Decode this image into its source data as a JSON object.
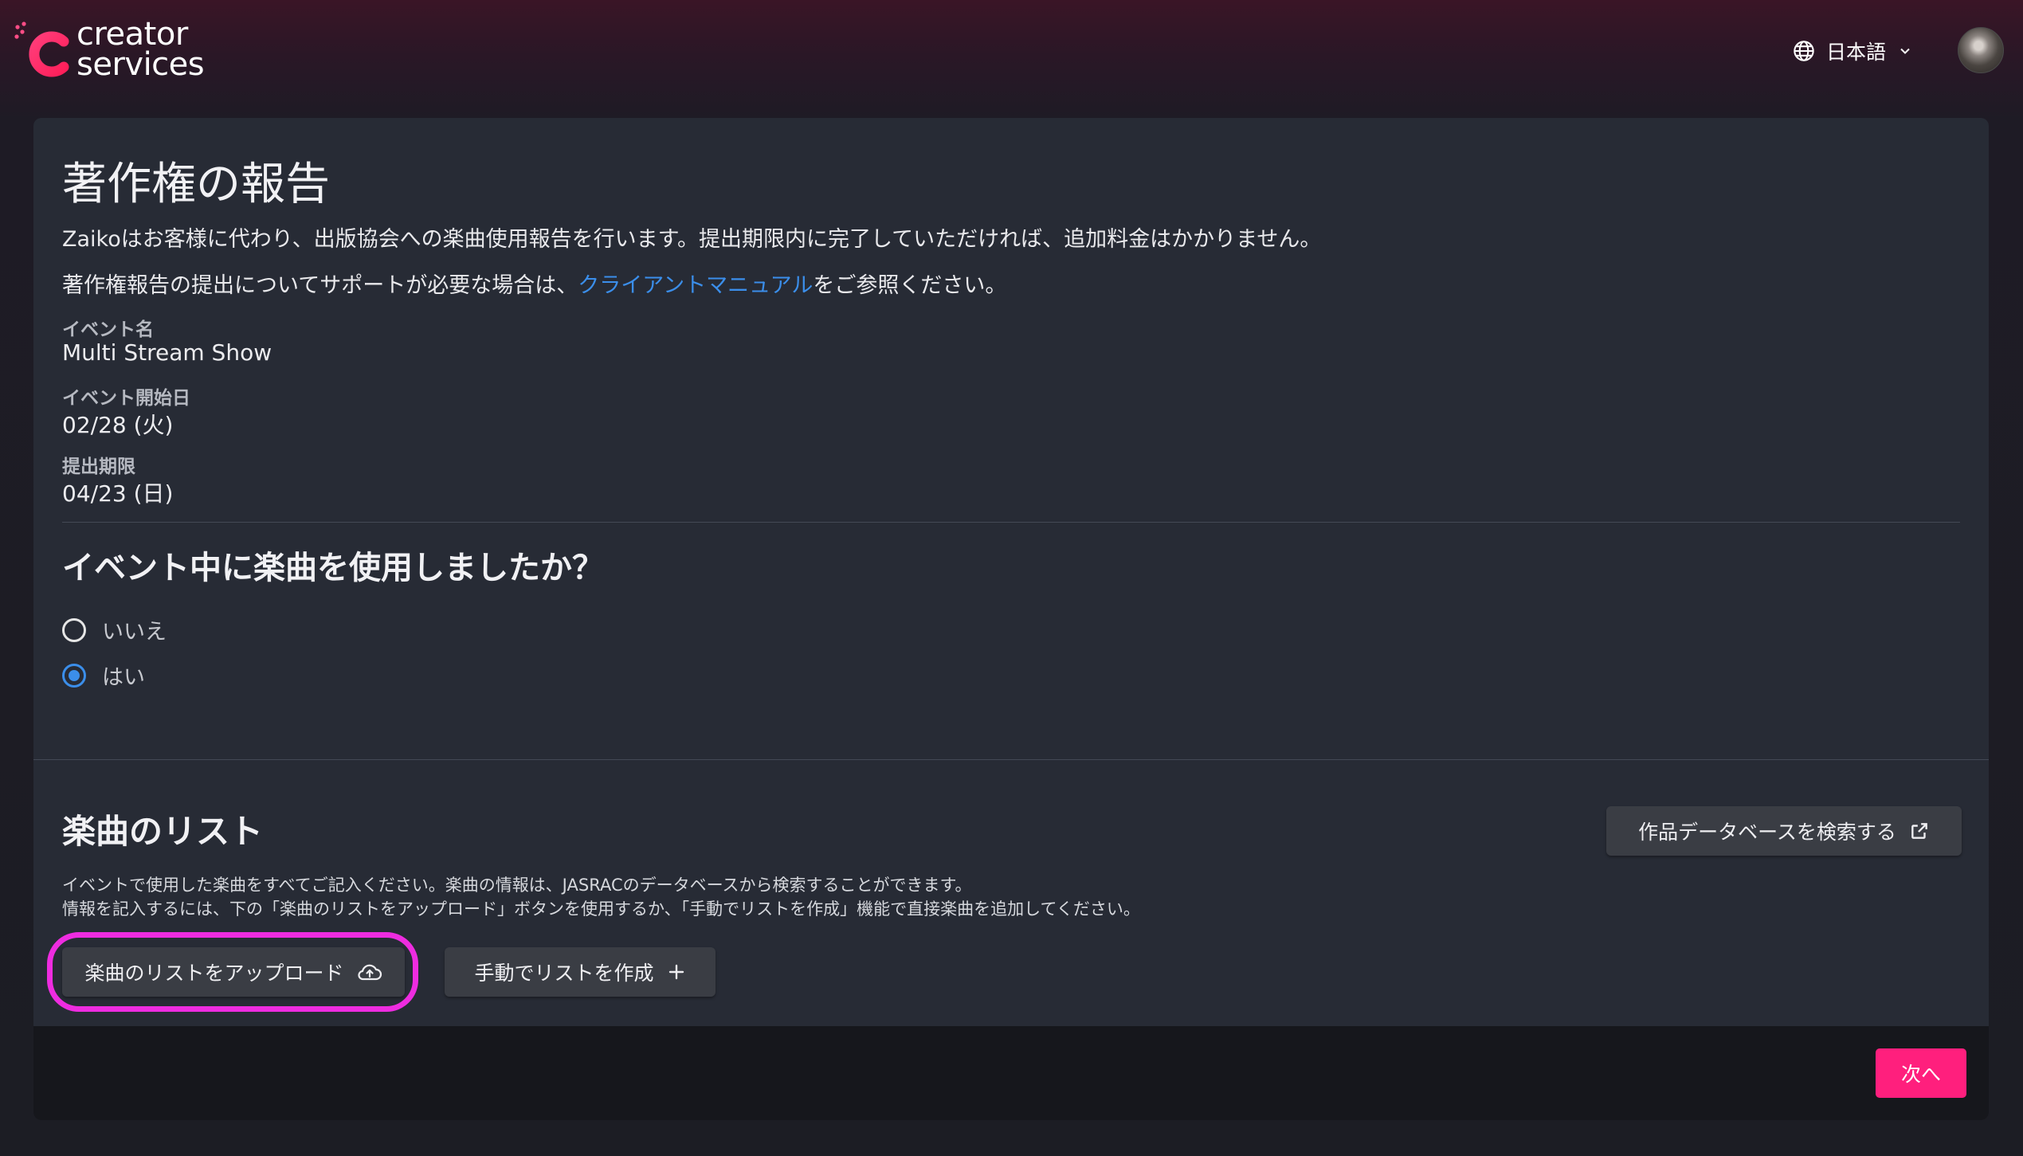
{
  "header": {
    "logo_line1": "creator",
    "logo_line2": "services",
    "language": "日本語"
  },
  "page": {
    "title": "著作権の報告",
    "description": "Zaikoはお客様に代わり、出版協会への楽曲使用報告を行います。提出期限内に完了していただければ、追加料金はかかりません。",
    "support_prefix": "著作権報告の提出についてサポートが必要な場合は、",
    "support_link": "クライアントマニュアル",
    "support_suffix": "をご参照ください。"
  },
  "event": {
    "name_label": "イベント名",
    "name_value": "Multi Stream Show",
    "start_label": "イベント開始日",
    "start_value": "02/28 (火)",
    "deadline_label": "提出期限",
    "deadline_value": "04/23 (日)"
  },
  "question": {
    "title": "イベント中に楽曲を使用しましたか？",
    "options": [
      {
        "label": "いいえ",
        "selected": false
      },
      {
        "label": "はい",
        "selected": true
      }
    ]
  },
  "songs": {
    "title": "楽曲のリスト",
    "search_db_button": "作品データベースを検索する",
    "text1": "イベントで使用した楽曲をすべてご記入ください。楽曲の情報は、JASRACのデータベースから検索することができます。",
    "text2": "情報を記入するには、下の「楽曲のリストをアップロード」ボタンを使用するか、「手動でリストを作成」機能で直接楽曲を追加してください。",
    "upload_button": "楽曲のリストをアップロード",
    "manual_button": "手動でリストを作成"
  },
  "footer": {
    "next_button": "次へ"
  },
  "colors": {
    "accent_pink": "#ff1f7d",
    "link_blue": "#3b8eea",
    "highlight_magenta": "#ee2ce0"
  }
}
